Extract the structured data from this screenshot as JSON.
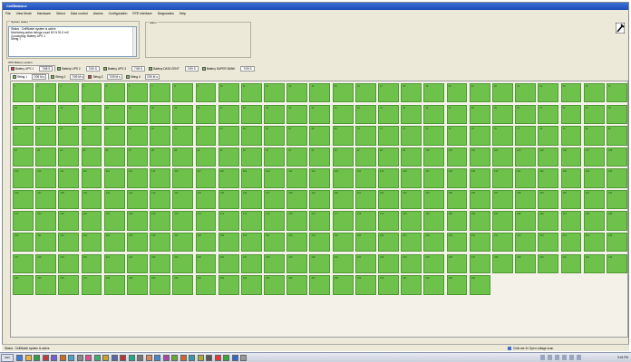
{
  "window": {
    "title": "CellBalance"
  },
  "menu": [
    "File",
    "View Mode",
    "Hardware",
    "Select",
    "Data control",
    "Alarms",
    "Configuration",
    "RTE interface",
    "Diagnostics",
    "Help"
  ],
  "status_window": {
    "label": "System status",
    "lines": [
      "Status : CellWatch system is active",
      "Monitoring active strings count 60 % 51.0 mV",
      "Connecting: Battery UPS 1",
      "String 7"
    ]
  },
  "alarm_group": {
    "label": "Alarm"
  },
  "systems_label": "UPS Battery system",
  "system_tabs": [
    {
      "label": "Battery UPS 1",
      "status_color": "#e33b2e",
      "count": "7/08 S",
      "active": true
    },
    {
      "label": "Battery UPS 2",
      "status_color": "#6ec24b",
      "count": "7/09 S",
      "active": false
    },
    {
      "label": "Battery UPS 3",
      "status_color": "#6ec24b",
      "count": "7/09 S",
      "active": false
    },
    {
      "label": "Battery DATA CENT",
      "status_color": "#6ec24b",
      "count": "7/09 S",
      "active": false
    },
    {
      "label": "Battery SUPER BANK",
      "status_color": "#6ec24b",
      "count": "7/09 S",
      "active": false
    }
  ],
  "string_tabs": [
    {
      "label": "String 1",
      "status_color": "#6ec24b",
      "count": "7/09 M s",
      "active": true
    },
    {
      "label": "String 2",
      "status_color": "#6ec24b",
      "count": "7/09 M s",
      "active": false
    },
    {
      "label": "String 3",
      "status_color": "#e33b2e",
      "count": "7/09 M s",
      "active": false
    },
    {
      "label": "String 4",
      "status_color": "#6ec24b",
      "count": "7/09 M s",
      "active": false
    }
  ],
  "cells": {
    "count": 264,
    "color": "#6ec24b",
    "border": "#4e9a32"
  },
  "statusbar": {
    "left": "Status : CellWatch system is active",
    "right": "Cells are 4x Open voltage scan"
  },
  "taskbar": {
    "start": "Start",
    "clock": "9:44 PM"
  }
}
